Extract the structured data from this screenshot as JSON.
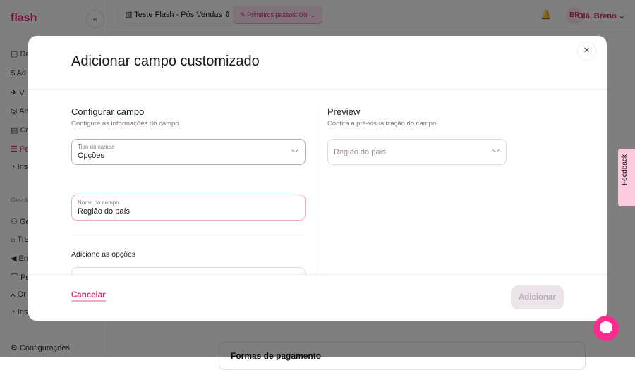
{
  "app": {
    "logo": "flash",
    "collapse": "«"
  },
  "sidebar": {
    "items": [
      {
        "label": "De"
      },
      {
        "label": "Ad"
      },
      {
        "label": "Vi"
      },
      {
        "label": "Ap"
      },
      {
        "label": "Co"
      },
      {
        "label": "Pe"
      },
      {
        "label": "Ins"
      }
    ],
    "section": "Gestão",
    "items2": [
      {
        "label": "Ge"
      },
      {
        "label": "Tre"
      },
      {
        "label": "En"
      },
      {
        "label": "Pe"
      },
      {
        "label": "Or"
      },
      {
        "label": "Ins"
      }
    ],
    "settings": "Configurações"
  },
  "topbar": {
    "company": "Teste Flash - Pós Vendas",
    "steps": "Primeiros passos: 0%",
    "avatar": "BP",
    "greeting": "Olá, Breno"
  },
  "background": {
    "card_title": "Formas de pagamento"
  },
  "modal": {
    "title": "Adicionar campo customizado",
    "config": {
      "title": "Configurar campo",
      "subtitle": "Configure as informações do campo",
      "type_label": "Tipo do campo",
      "type_value": "Opções",
      "name_label": "Nome do campo",
      "name_value": "Região do país",
      "options_title": "Adicione as opções"
    },
    "preview": {
      "title": "Preview",
      "subtitle": "Confira a pré-visualização do campo",
      "placeholder": "Região do país"
    },
    "cancel": "Cancelar",
    "add": "Adicionar"
  },
  "feedback": "Feedback",
  "colors": {
    "brand": "#e0226e",
    "chat": "#fe2b8f",
    "focus_border": "#f7a6c4"
  }
}
